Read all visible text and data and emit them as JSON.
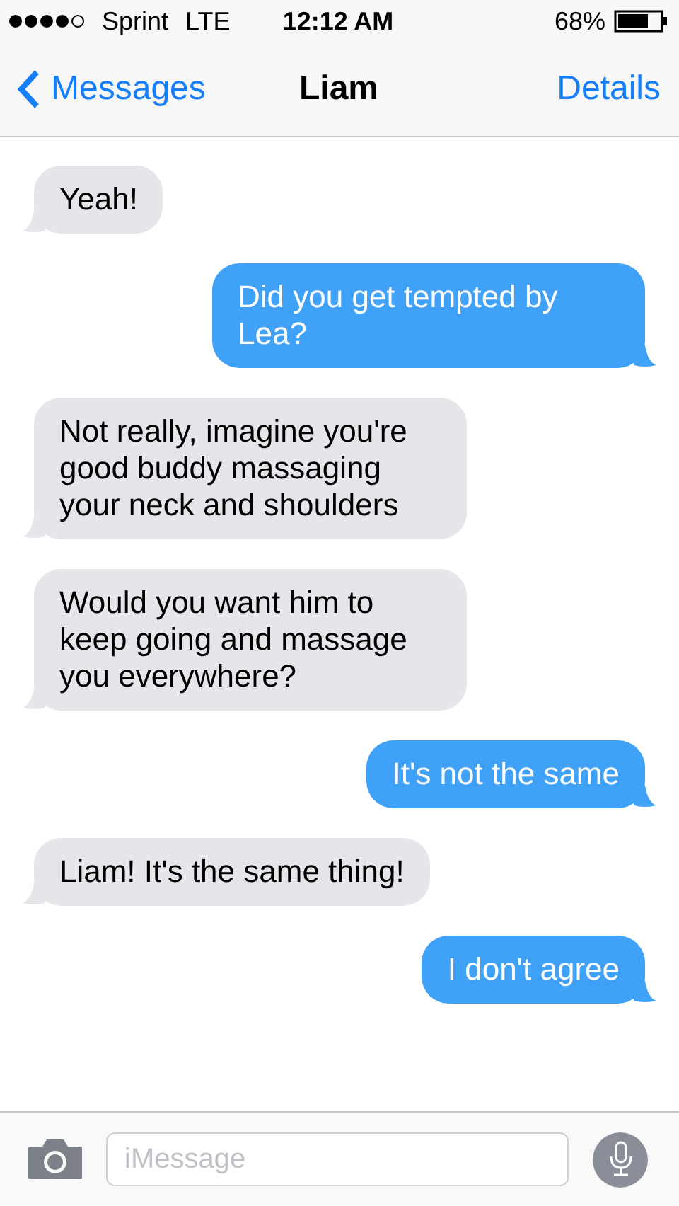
{
  "status_bar": {
    "carrier": "Sprint",
    "network": "LTE",
    "time": "12:12 AM",
    "battery": "68%"
  },
  "nav_bar": {
    "back": "Messages",
    "title": "Liam",
    "action": "Details"
  },
  "messages": [
    {
      "kind": "received",
      "text": "Yeah!"
    },
    {
      "kind": "sent",
      "text": "Did you get tempted by Lea?"
    },
    {
      "kind": "received",
      "text": "Not really, imagine you're good buddy massaging your neck and shoulders"
    },
    {
      "kind": "received",
      "text": "Would you want him to keep going and massage you everywhere?"
    },
    {
      "kind": "sent",
      "text": "It's not the same"
    },
    {
      "kind": "received",
      "text": "Liam! It's the same thing!"
    },
    {
      "kind": "sent",
      "text": "I don't agree"
    }
  ],
  "composer": {
    "placeholder": "iMessage"
  }
}
